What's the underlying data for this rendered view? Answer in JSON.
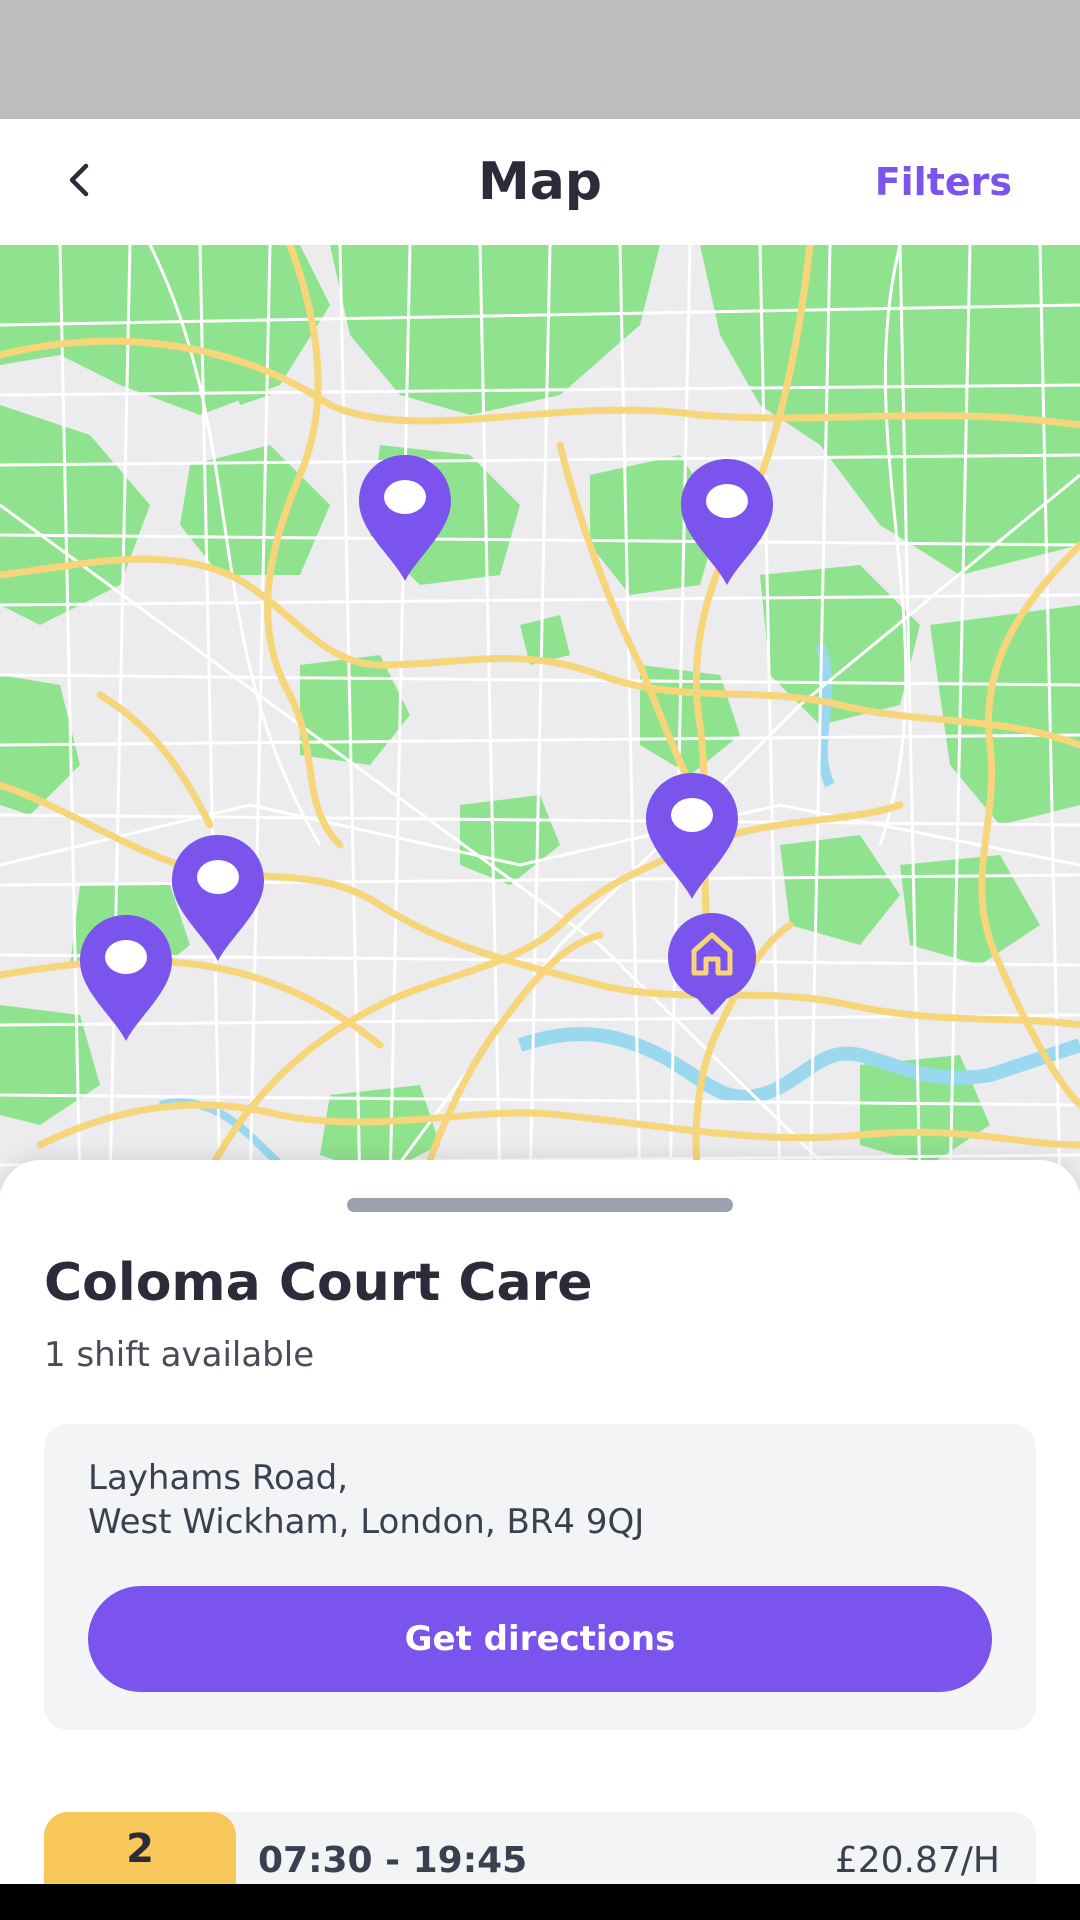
{
  "header": {
    "back_icon": "chevron-left-icon",
    "title": "Map",
    "filters_label": "Filters"
  },
  "map": {
    "pin_icon": "location-pin-icon",
    "home_icon": "home-icon",
    "pin_count": 5,
    "colors": {
      "accent": "#7a54ec",
      "park": "#8fe38f",
      "road_major": "#f7d57a",
      "road_minor": "#ffffff",
      "water": "#9ad8f0",
      "land": "#ecebee"
    }
  },
  "sheet": {
    "place_name": "Coloma Court Care",
    "shift_count_text": "1 shift available",
    "address_line1": "Layhams Road,",
    "address_line2": "West Wickham, London, BR4 9QJ",
    "directions_label": "Get directions"
  },
  "shift": {
    "day": "2",
    "time": "07:30 - 19:45",
    "rate": "£20.87/H"
  },
  "colors": {
    "accent": "#7a54ec",
    "badge": "#f7c75a"
  }
}
